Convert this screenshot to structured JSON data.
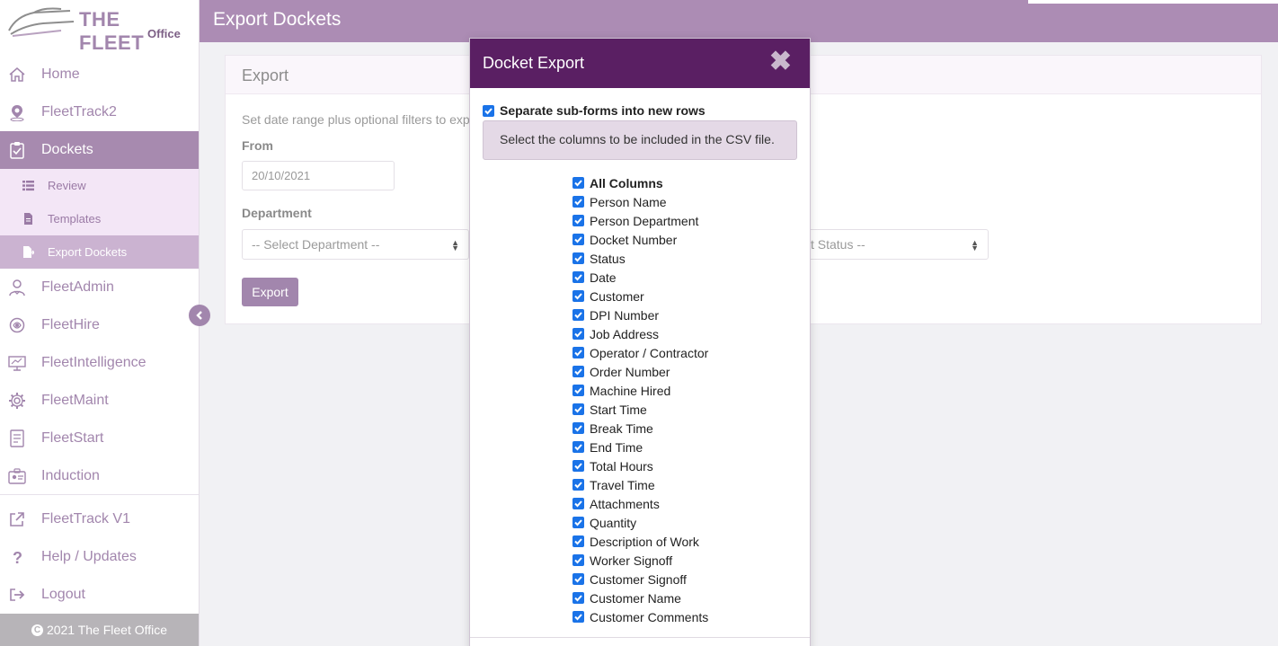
{
  "logo": {
    "brand": "THE FLEET",
    "sub": "Office"
  },
  "header": {
    "title": "Export Dockets"
  },
  "sidebar": {
    "items": [
      {
        "label": "Home",
        "icon": "home-icon"
      },
      {
        "label": "FleetTrack2",
        "icon": "map-pin-icon"
      },
      {
        "label": "Dockets",
        "icon": "clipboard-check-icon",
        "active": true
      },
      {
        "label": "FleetAdmin",
        "icon": "admin-user-icon"
      },
      {
        "label": "FleetHire",
        "icon": "hire-cycle-icon"
      },
      {
        "label": "FleetIntelligence",
        "icon": "presentation-icon"
      },
      {
        "label": "FleetMaint",
        "icon": "gear-icon"
      },
      {
        "label": "FleetStart",
        "icon": "checklist-icon"
      },
      {
        "label": "Induction",
        "icon": "id-badge-icon"
      }
    ],
    "subitems": [
      {
        "label": "Review",
        "icon": "list-icon"
      },
      {
        "label": "Templates",
        "icon": "file-icon"
      },
      {
        "label": "Export Dockets",
        "icon": "file-export-icon",
        "active": true
      }
    ],
    "bottom": [
      {
        "label": "FleetTrack V1",
        "icon": "external-link-icon"
      },
      {
        "label": "Help / Updates",
        "icon": "question-icon"
      },
      {
        "label": "Logout",
        "icon": "logout-icon"
      }
    ],
    "footer": "2021 The Fleet Office"
  },
  "panel": {
    "title": "Export",
    "description": "Set date range plus optional filters to expo",
    "from_label": "From",
    "from_value": "20/10/2021",
    "department_label": "Department",
    "department_placeholder": "-- Select Department --",
    "status_placeholder": "t Status --",
    "export_button": "Export"
  },
  "modal": {
    "title": "Docket Export",
    "separate_label": "Separate sub-forms into new rows",
    "hint": "Select the columns to be included in the CSV file.",
    "all_columns": "All Columns",
    "columns": [
      "Person Name",
      "Person Department",
      "Docket Number",
      "Status",
      "Date",
      "Customer",
      "DPI Number",
      "Job Address",
      "Operator / Contractor",
      "Order Number",
      "Machine Hired",
      "Start Time",
      "Break Time",
      "End Time",
      "Total Hours",
      "Travel Time",
      "Attachments",
      "Quantity",
      "Description of Work",
      "Worker Signoff",
      "Customer Signoff",
      "Customer Name",
      "Customer Comments"
    ]
  },
  "colors": {
    "accent": "#a286ad",
    "modal_header": "#5a1f63",
    "header": "#ac8cb4"
  }
}
